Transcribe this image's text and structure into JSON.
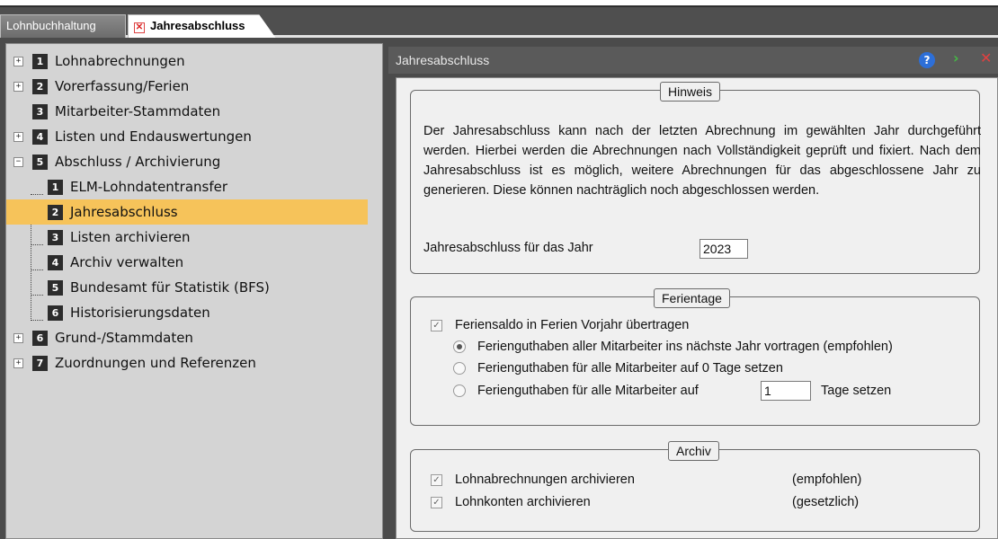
{
  "tabs": {
    "lohn": "Lohnbuchhaltung",
    "jahr": "Jahresabschluss",
    "close_glyph": "✕"
  },
  "tree": {
    "items": [
      {
        "expander": "+",
        "num": "1",
        "label": "Lohnabrechnungen"
      },
      {
        "expander": "+",
        "num": "2",
        "label": "Vorerfassung/Ferien"
      },
      {
        "expander": "",
        "num": "3",
        "label": "Mitarbeiter-Stammdaten"
      },
      {
        "expander": "+",
        "num": "4",
        "label": "Listen und Endauswertungen"
      },
      {
        "expander": "−",
        "num": "5",
        "label": "Abschluss / Archivierung"
      },
      {
        "num": "1",
        "label": "ELM-Lohndatentransfer"
      },
      {
        "num": "2",
        "label": "Jahresabschluss",
        "selected": true
      },
      {
        "num": "3",
        "label": "Listen archivieren"
      },
      {
        "num": "4",
        "label": "Archiv verwalten"
      },
      {
        "num": "5",
        "label": "Bundesamt für Statistik (BFS)"
      },
      {
        "num": "6",
        "label": "Historisierungsdaten"
      },
      {
        "expander": "+",
        "num": "6",
        "label": "Grund-/Stammdaten"
      },
      {
        "expander": "+",
        "num": "7",
        "label": "Zuordnungen und Referenzen"
      }
    ]
  },
  "panel": {
    "title": "Jahresabschluss",
    "help_glyph": "?",
    "next_glyph": "›",
    "close_glyph": "✕"
  },
  "hinweis": {
    "legend": "Hinweis",
    "text": "Der Jahresabschluss kann nach der letzten Abrechnung im gewählten Jahr durchgeführt werden. Hierbei werden die Abrechnungen nach Vollständigkeit geprüft und fixiert. Nach dem Jahresabschluss ist es möglich, weitere Abrechnungen für das abgeschlossene Jahr zu generieren. Diese können nachträglich noch abgeschlossen werden.",
    "year_label": "Jahresabschluss für das Jahr",
    "year_value": "2023"
  },
  "ferientage": {
    "legend": "Ferientage",
    "checkbox_label": "Feriensaldo in Ferien Vorjahr übertragen",
    "checked": true,
    "options": [
      "Ferienguthaben aller Mitarbeiter ins nächste Jahr vortragen (empfohlen)",
      "Ferienguthaben für alle Mitarbeiter auf 0 Tage setzen",
      "Ferienguthaben für alle Mitarbeiter auf"
    ],
    "selected_option": 0,
    "days_value": "1",
    "days_suffix": "Tage setzen"
  },
  "archiv": {
    "legend": "Archiv",
    "items": [
      {
        "label": "Lohnabrechnungen archivieren",
        "note": "(empfohlen)",
        "checked": true
      },
      {
        "label": "Lohnkonten archivieren",
        "note": "(gesetzlich)",
        "checked": true
      }
    ]
  },
  "glyphs": {
    "check": "✓"
  }
}
